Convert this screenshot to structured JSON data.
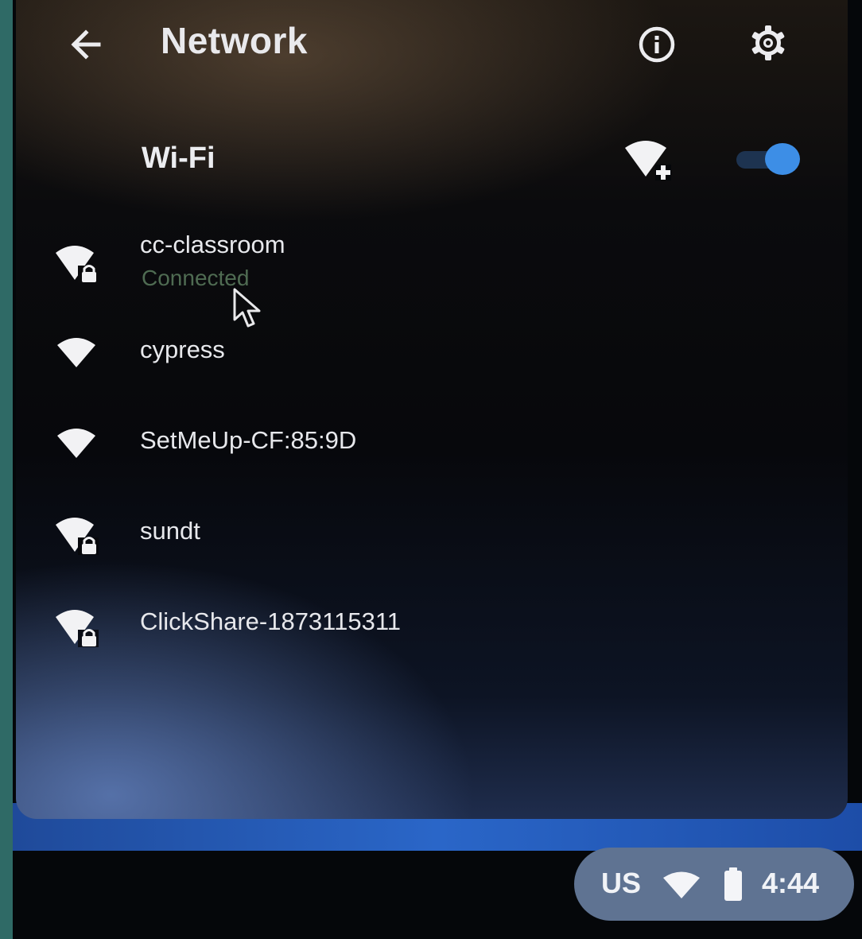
{
  "header": {
    "back_icon": "arrow-back-icon",
    "title": "Network",
    "info_icon": "info-icon",
    "settings_icon": "gear-icon"
  },
  "wifi": {
    "label": "Wi-Fi",
    "add_network_icon": "wifi-add-icon",
    "enabled": true
  },
  "networks": [
    {
      "name": "cc-classroom",
      "status": "Connected",
      "secured": true
    },
    {
      "name": "cypress",
      "status": "",
      "secured": false
    },
    {
      "name": "SetMeUp-CF:85:9D",
      "status": "",
      "secured": false
    },
    {
      "name": "sundt",
      "status": "",
      "secured": true
    },
    {
      "name": "ClickShare-1873115311",
      "status": "",
      "secured": true
    }
  ],
  "tray": {
    "language": "US",
    "wifi_icon": "wifi-icon",
    "battery_icon": "battery-icon",
    "time": "4:44"
  },
  "colors": {
    "accent": "#3d8ee6",
    "connected_status": "#4f6b52",
    "tray_background": "#5f7392"
  }
}
